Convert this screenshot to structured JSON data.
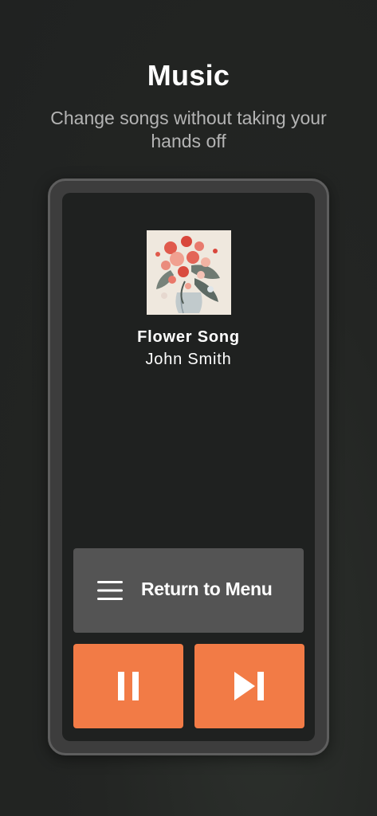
{
  "header": {
    "title": "Music",
    "subtitle": "Change songs without taking your hands off"
  },
  "player": {
    "song_title": "Flower Song",
    "artist": "John Smith",
    "album_art_icon": "flower-bouquet-artwork"
  },
  "controls": {
    "menu_label": "Return to Menu",
    "menu_icon": "hamburger-menu-icon",
    "pause_icon": "pause-icon",
    "next_icon": "skip-next-icon"
  },
  "colors": {
    "background": "#222423",
    "device_frame": "#3d3d3d",
    "screen": "#1f2120",
    "menu_button": "#545454",
    "accent": "#f27b46"
  }
}
